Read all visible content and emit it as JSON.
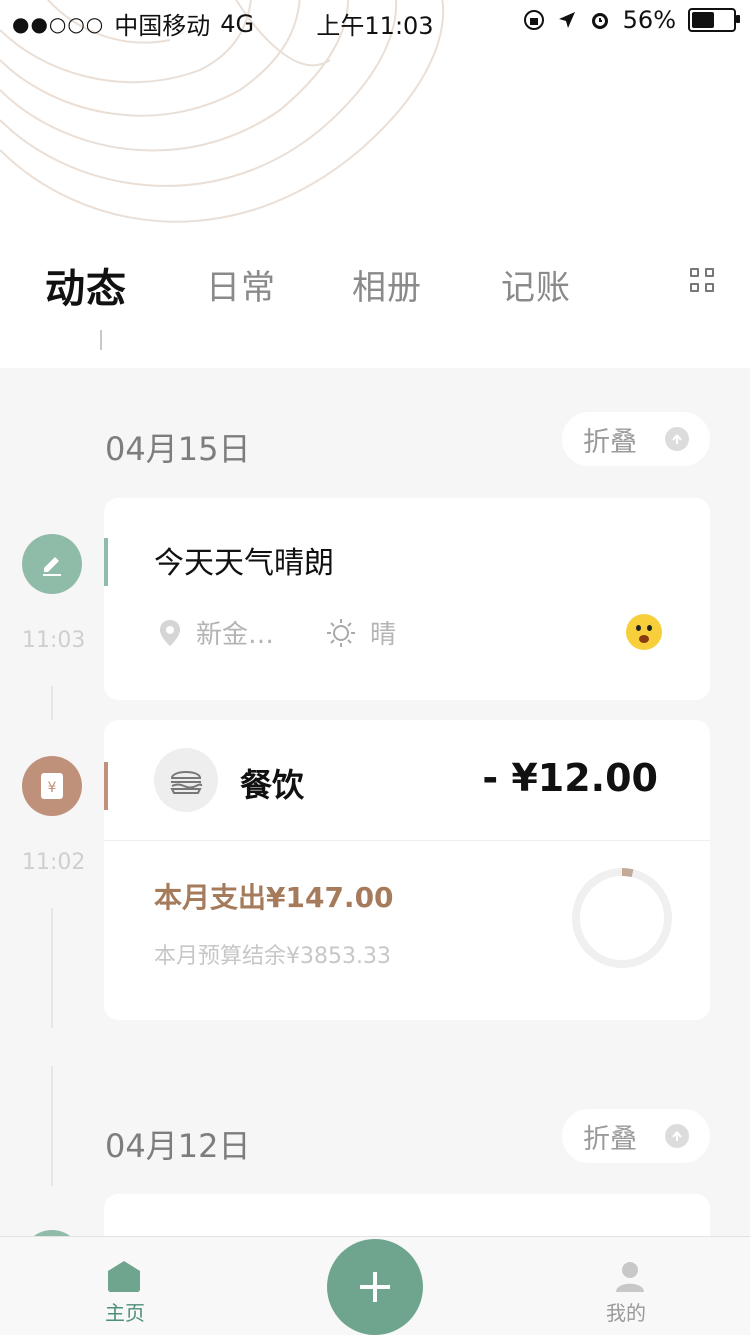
{
  "status_bar": {
    "carrier": "中国移动",
    "network": "4G",
    "time": "上午11:03",
    "battery_percent": 56,
    "battery_label": "56%"
  },
  "tabs": [
    {
      "label": "动态",
      "active": true
    },
    {
      "label": "日常",
      "active": false
    },
    {
      "label": "相册",
      "active": false
    },
    {
      "label": "记账",
      "active": false
    }
  ],
  "groups": [
    {
      "date": "04月15日",
      "fold_label": "折叠",
      "entries": [
        {
          "kind": "note",
          "time": "11:03",
          "text": "今天天气晴朗",
          "location": "新金…",
          "weather": "晴",
          "mood_icon": "smiley-emoji-icon"
        },
        {
          "kind": "expense",
          "time": "11:02",
          "category": "餐饮",
          "amount": "- ¥12.00",
          "month_spend": "本月支出¥147.00",
          "month_budget_left": "本月预算结余¥3853.33",
          "budget_used_fraction": 0.037
        }
      ]
    },
    {
      "date": "04月12日",
      "fold_label": "折叠"
    }
  ],
  "bottom_nav": {
    "home_label": "主页",
    "mine_label": "我的"
  },
  "colors": {
    "accent_green": "#8fbba9",
    "accent_brown": "#c0917a",
    "nav_active": "#4f8f78"
  }
}
